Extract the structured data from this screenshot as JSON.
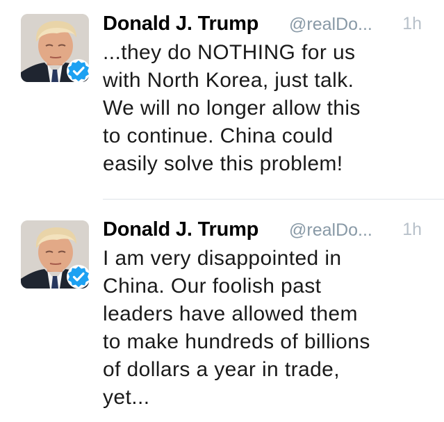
{
  "tweets": [
    {
      "author_name": "Donald J. Trump",
      "handle": "@realDo...",
      "time": "1h",
      "verified": true,
      "text": "...they do NOTHING for us\nwith North Korea, just talk.\nWe will no longer allow this\nto continue. China could\neasily solve this problem!"
    },
    {
      "author_name": "Donald J. Trump",
      "handle": "@realDo...",
      "time": "1h",
      "verified": true,
      "text": "I am very disappointed in\nChina. Our foolish past\nleaders have allowed them\nto make hundreds of billions\nof dollars a year in trade,\nyet..."
    }
  ],
  "colors": {
    "verified_badge": "#1da1f2",
    "handle": "#8899a6",
    "separator": "#dde3e8"
  },
  "icons": {
    "verified": "verified-badge-icon",
    "avatar": "profile-photo"
  }
}
